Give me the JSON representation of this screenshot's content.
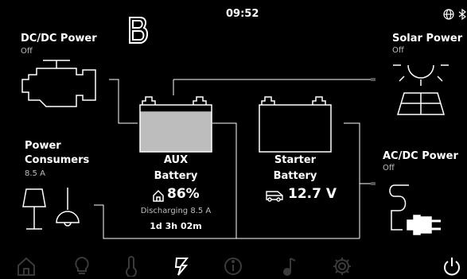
{
  "status_bar": {
    "time": "09:52"
  },
  "dcdc": {
    "title": "DC/DC Power",
    "status": "Off"
  },
  "solar": {
    "title": "Solar Power",
    "status": "Off"
  },
  "consumers": {
    "title_line1": "Power",
    "title_line2": "Consumers",
    "value": "8.5 A"
  },
  "acdc": {
    "title": "AC/DC Power",
    "status": "Off"
  },
  "aux": {
    "name_line1": "AUX",
    "name_line2": "Battery",
    "soc": "86%",
    "state": "Discharging 8.5 A",
    "time_left": "1d 3h 02m",
    "fill_fraction": 0.86
  },
  "starter": {
    "name_line1": "Starter",
    "name_line2": "Battery",
    "voltage": "12.7 V"
  },
  "nav": {
    "items": [
      "home-icon",
      "lightbulb-icon",
      "thermometer-icon",
      "power-icon",
      "info-icon",
      "music-icon",
      "settings-icon",
      "power-off-icon"
    ],
    "active": "power-icon"
  },
  "colors": {
    "background": "#000000",
    "text": "#ffffff",
    "muted": "#bdbdbd",
    "nav_inactive": "#3a3a3a"
  }
}
